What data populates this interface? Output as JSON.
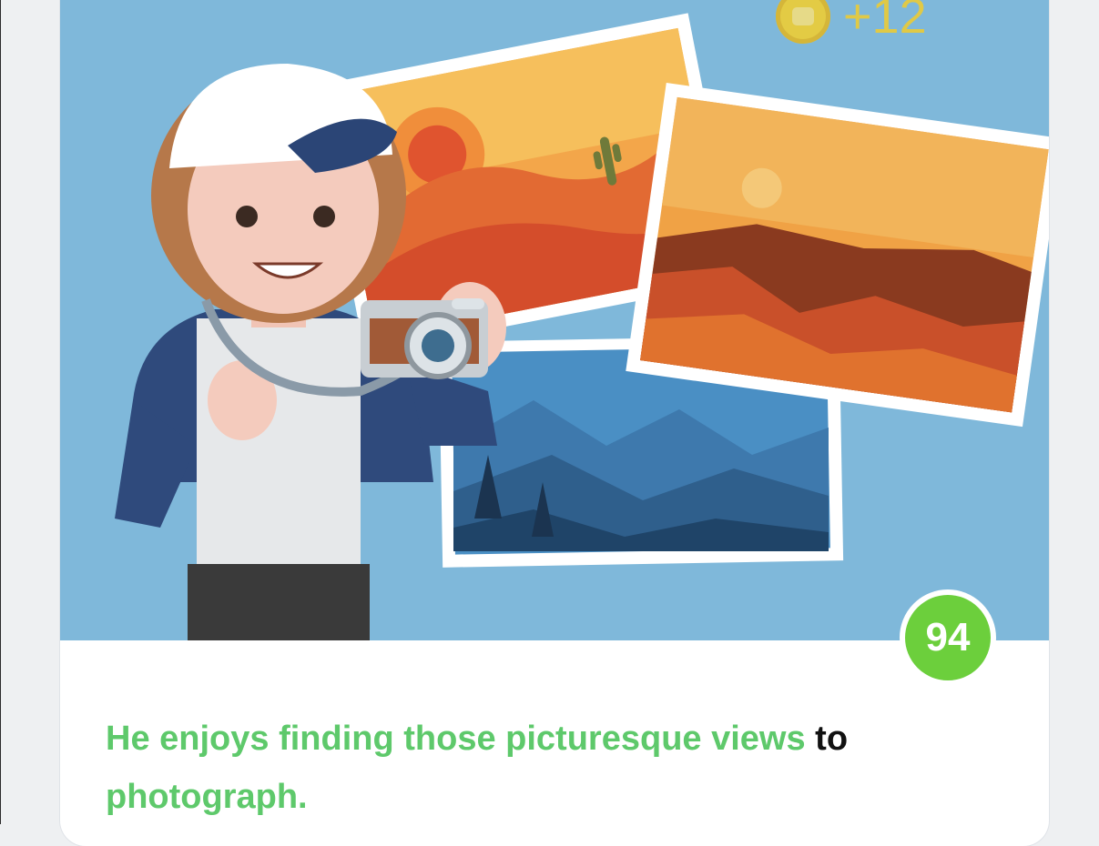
{
  "reward": {
    "coin_icon": "coin-icon",
    "amount": "+12"
  },
  "score": {
    "value": "94",
    "color": "#6ccf3c"
  },
  "sentence": {
    "highlight_1": "He enjoys finding those picturesque views",
    "plain_1": " to ",
    "highlight_2": "photograph.",
    "highlight_color": "#5ec96b"
  },
  "illustration": {
    "background_color": "#7fb8da",
    "subject": "photographer-with-camera-and-landscape-photos"
  }
}
